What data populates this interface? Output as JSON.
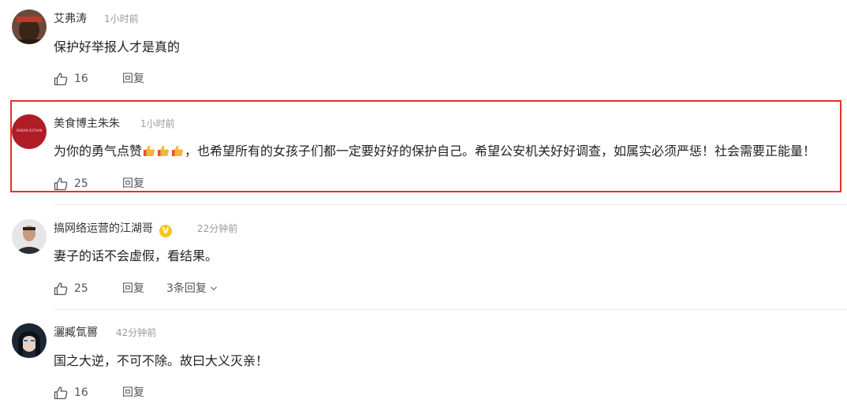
{
  "comments": [
    {
      "username": "艾弗涛",
      "time": "1小时前",
      "text": "保护好举报人才是真的",
      "likes": "16",
      "reply_label": "回复"
    },
    {
      "username": "美食博主朱朱",
      "time": "1小时前",
      "text_before": "为你的勇气点赞",
      "text_after": "，也希望所有的女孩子们都一定要好好的保护自己。希望公安机关好好调查，如属实必须严惩！社会需要正能量！",
      "likes": "25",
      "reply_label": "回复",
      "avatar_text": "ISHKAN SUTHAN",
      "highlighted": true
    },
    {
      "username": "搞网络运营的江湖哥",
      "badge": "V",
      "time": "22分钟前",
      "text": "妻子的话不会虚假，看结果。",
      "likes": "25",
      "reply_label": "回复",
      "replies_label": "3条回复"
    },
    {
      "username": "灑臧氜嘼",
      "time": "42分钟前",
      "text": "国之大逆，不可不除。故曰大义灭亲！",
      "likes": "16",
      "reply_label": "回复"
    }
  ],
  "colors": {
    "highlight_border": "#e5312d",
    "verified_badge": "#f5c518",
    "avatar2_bg": "#b01d27"
  }
}
